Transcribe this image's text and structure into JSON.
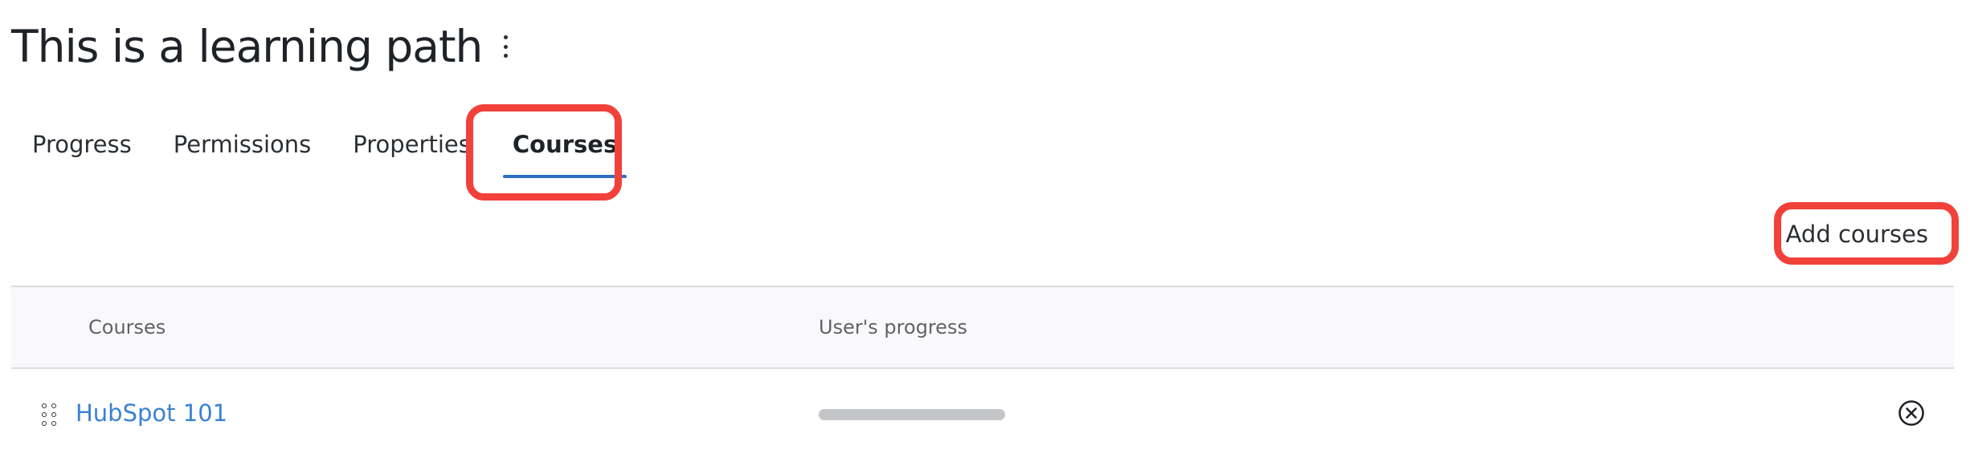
{
  "page": {
    "title": "This is a learning path"
  },
  "tabs": [
    {
      "label": "Progress",
      "active": false
    },
    {
      "label": "Permissions",
      "active": false
    },
    {
      "label": "Properties",
      "active": false
    },
    {
      "label": "Courses",
      "active": true
    }
  ],
  "actions": {
    "add_courses_label": "Add courses"
  },
  "table": {
    "columns": [
      "Courses",
      "User's progress"
    ],
    "rows": [
      {
        "course": "HubSpot 101",
        "progress": 0
      }
    ]
  },
  "colors": {
    "accent": "#2f6fc6",
    "link": "#3b82d0",
    "highlight": "#f2413a"
  },
  "icons": {
    "more": "kebab-menu-icon",
    "drag": "drag-handle-icon",
    "remove": "remove-circle-x-icon"
  }
}
